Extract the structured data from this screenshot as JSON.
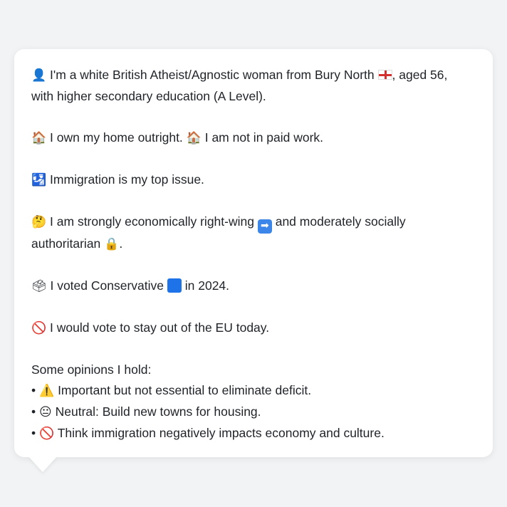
{
  "card": {
    "line1": "I'm a white British Atheist/Agnostic woman from Bury North",
    "line1_tail": ", aged 56,",
    "line2": "with higher secondary education (A Level).",
    "home_a": "I own my home outright.",
    "home_b": "I am not in paid work.",
    "issue": "Immigration is my top issue.",
    "econ_a": "I am strongly economically right-wing",
    "econ_b": "and moderately socially",
    "econ_c": "authoritarian",
    "econ_d": ".",
    "vote_a": "I voted Conservative",
    "vote_b": "in 2024.",
    "eu": "I would vote to stay out of the EU today.",
    "opinions_header": "Some opinions I hold:",
    "opinions": [
      "Important but not essential to eliminate deficit.",
      "Neutral: Build new towns for housing.",
      "Think immigration negatively impacts economy and culture."
    ],
    "bullet": "•"
  },
  "icons": {
    "person": "👤",
    "house": "🏠",
    "immigration": "🛂",
    "thinking": "🤔",
    "lock": "🔒",
    "ballot": "🗳",
    "no": "🚫",
    "warning": "⚠️",
    "neutral": "😐"
  },
  "colors": {
    "background": "#f1f3f5",
    "bubble": "#ffffff",
    "conservative_blue": "#1e73e8",
    "arrow_blue": "#3b86e8"
  }
}
